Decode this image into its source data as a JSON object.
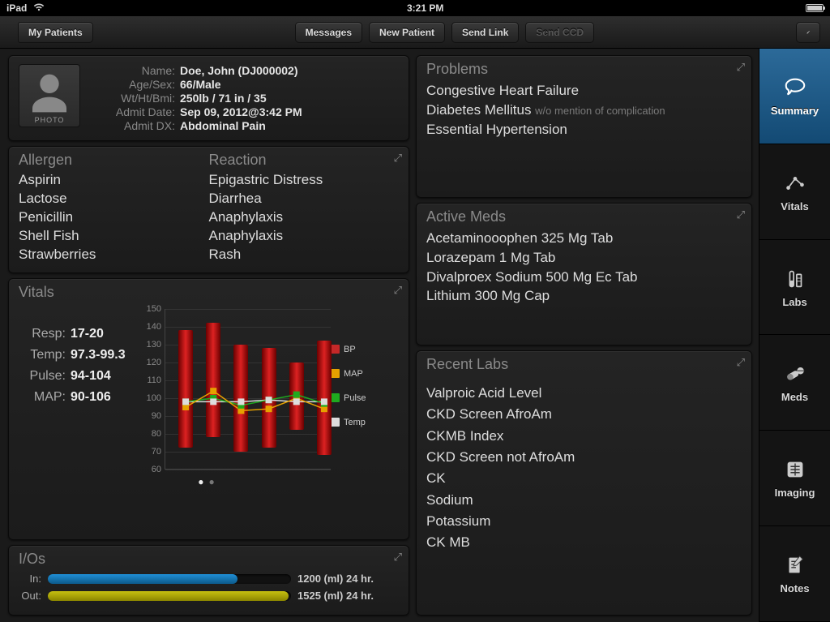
{
  "status": {
    "device": "iPad",
    "time": "3:21 PM"
  },
  "nav": {
    "back": "My Patients",
    "messages": "Messages",
    "new_patient": "New Patient",
    "send_link": "Send Link",
    "send_ccd": "Send CCD"
  },
  "patient": {
    "labels": {
      "name": "Name:",
      "agesex": "Age/Sex:",
      "wthtbmi": "Wt/Ht/Bmi:",
      "admit_date": "Admit Date:",
      "admit_dx": "Admit DX:"
    },
    "name": "Doe, John  (DJ000002)",
    "agesex": "66/Male",
    "wthtbmi": "250lb / 71 in / 35",
    "admit_date": "Sep 09, 2012@3:42 PM",
    "admit_dx": "Abdominal Pain",
    "photo_label": "PHOTO"
  },
  "allergies": {
    "hdr_allergen": "Allergen",
    "hdr_reaction": "Reaction",
    "rows": [
      {
        "a": "Aspirin",
        "r": "Epigastric Distress"
      },
      {
        "a": "Lactose",
        "r": "Diarrhea"
      },
      {
        "a": "Penicillin",
        "r": "Anaphylaxis"
      },
      {
        "a": "Shell Fish",
        "r": "Anaphylaxis"
      },
      {
        "a": "Strawberries",
        "r": "Rash"
      }
    ]
  },
  "vitals": {
    "title": "Vitals",
    "labels": {
      "resp": "Resp:",
      "temp": "Temp:",
      "pulse": "Pulse:",
      "map": "MAP:"
    },
    "resp": "17-20",
    "temp": "97.3-99.3",
    "pulse": "94-104",
    "map": "90-106",
    "legend": {
      "bp": "BP",
      "map": "MAP",
      "pulse": "Pulse",
      "temp": "Temp"
    }
  },
  "ios": {
    "title": "I/Os",
    "in_label": "In:",
    "out_label": "Out:",
    "in_value": "1200 (ml) 24 hr.",
    "out_value": "1525 (ml) 24 hr.",
    "in_pct": 78,
    "out_pct": 99,
    "in_color": "#1f8fd6",
    "out_color": "#c7c010"
  },
  "problems": {
    "title": "Problems",
    "items": [
      {
        "t": "Congestive Heart Failure",
        "q": ""
      },
      {
        "t": "Diabetes Mellitus",
        "q": "w/o mention of complication"
      },
      {
        "t": "Essential Hypertension",
        "q": ""
      }
    ]
  },
  "active_meds": {
    "title": "Active Meds",
    "items": [
      "Acetaminooophen 325 Mg Tab",
      "Lorazepam 1 Mg Tab",
      "Divalproex Sodium 500 Mg Ec Tab",
      "Lithium 300 Mg Cap"
    ]
  },
  "recent_labs": {
    "title": "Recent Labs",
    "items": [
      "Valproic Acid Level",
      "CKD Screen AfroAm",
      "CKMB Index",
      "CKD Screen not AfroAm",
      "CK",
      "Sodium",
      "Potassium",
      "CK MB"
    ]
  },
  "sidebar": {
    "items": [
      {
        "key": "summary",
        "label": "Summary"
      },
      {
        "key": "vitals",
        "label": "Vitals"
      },
      {
        "key": "labs",
        "label": "Labs"
      },
      {
        "key": "meds",
        "label": "Meds"
      },
      {
        "key": "imaging",
        "label": "Imaging"
      },
      {
        "key": "notes",
        "label": "Notes"
      }
    ]
  },
  "chart_data": {
    "type": "range-bar-with-markers",
    "ylim": [
      60,
      150
    ],
    "yticks": [
      60,
      70,
      80,
      90,
      100,
      110,
      120,
      130,
      140,
      150
    ],
    "x_count": 6,
    "series": [
      {
        "name": "BP",
        "kind": "range",
        "color": "#c62828",
        "values": [
          [
            72,
            138
          ],
          [
            78,
            142
          ],
          [
            70,
            130
          ],
          [
            72,
            128
          ],
          [
            82,
            120
          ],
          [
            68,
            132
          ]
        ]
      },
      {
        "name": "MAP",
        "kind": "point",
        "color": "#e6a100",
        "values": [
          95,
          104,
          93,
          94,
          100,
          94
        ]
      },
      {
        "name": "Pulse",
        "kind": "point",
        "color": "#1faa1f",
        "values": [
          98,
          100,
          96,
          99,
          102,
          97
        ]
      },
      {
        "name": "Temp",
        "kind": "point",
        "color": "#dddddd",
        "values": [
          98,
          98,
          98,
          99,
          98,
          98
        ]
      }
    ],
    "legend": [
      "BP",
      "MAP",
      "Pulse",
      "Temp"
    ]
  }
}
